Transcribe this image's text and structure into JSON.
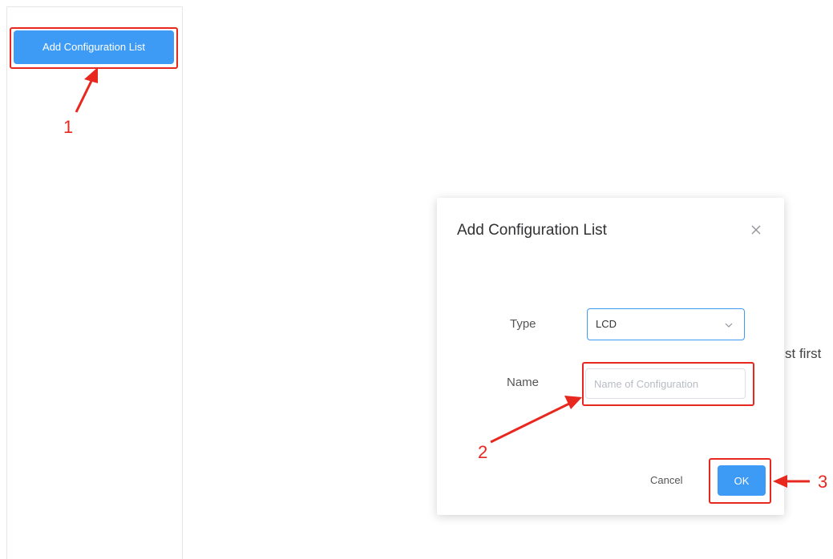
{
  "sidebar": {
    "add_button_label": "Add Configuration List"
  },
  "background": {
    "partial_text": "st first"
  },
  "dialog": {
    "title": "Add Configuration List",
    "close_icon": "close-icon",
    "type_label": "Type",
    "type_value": "LCD",
    "name_label": "Name",
    "name_placeholder": "Name of Configuration",
    "name_value": "",
    "cancel_label": "Cancel",
    "ok_label": "OK"
  },
  "annotations": {
    "step1": "1",
    "step2": "2",
    "step3": "3",
    "color": "#e8281e"
  },
  "colors": {
    "accent": "#3e9bf5",
    "highlight": "#e8281e"
  }
}
